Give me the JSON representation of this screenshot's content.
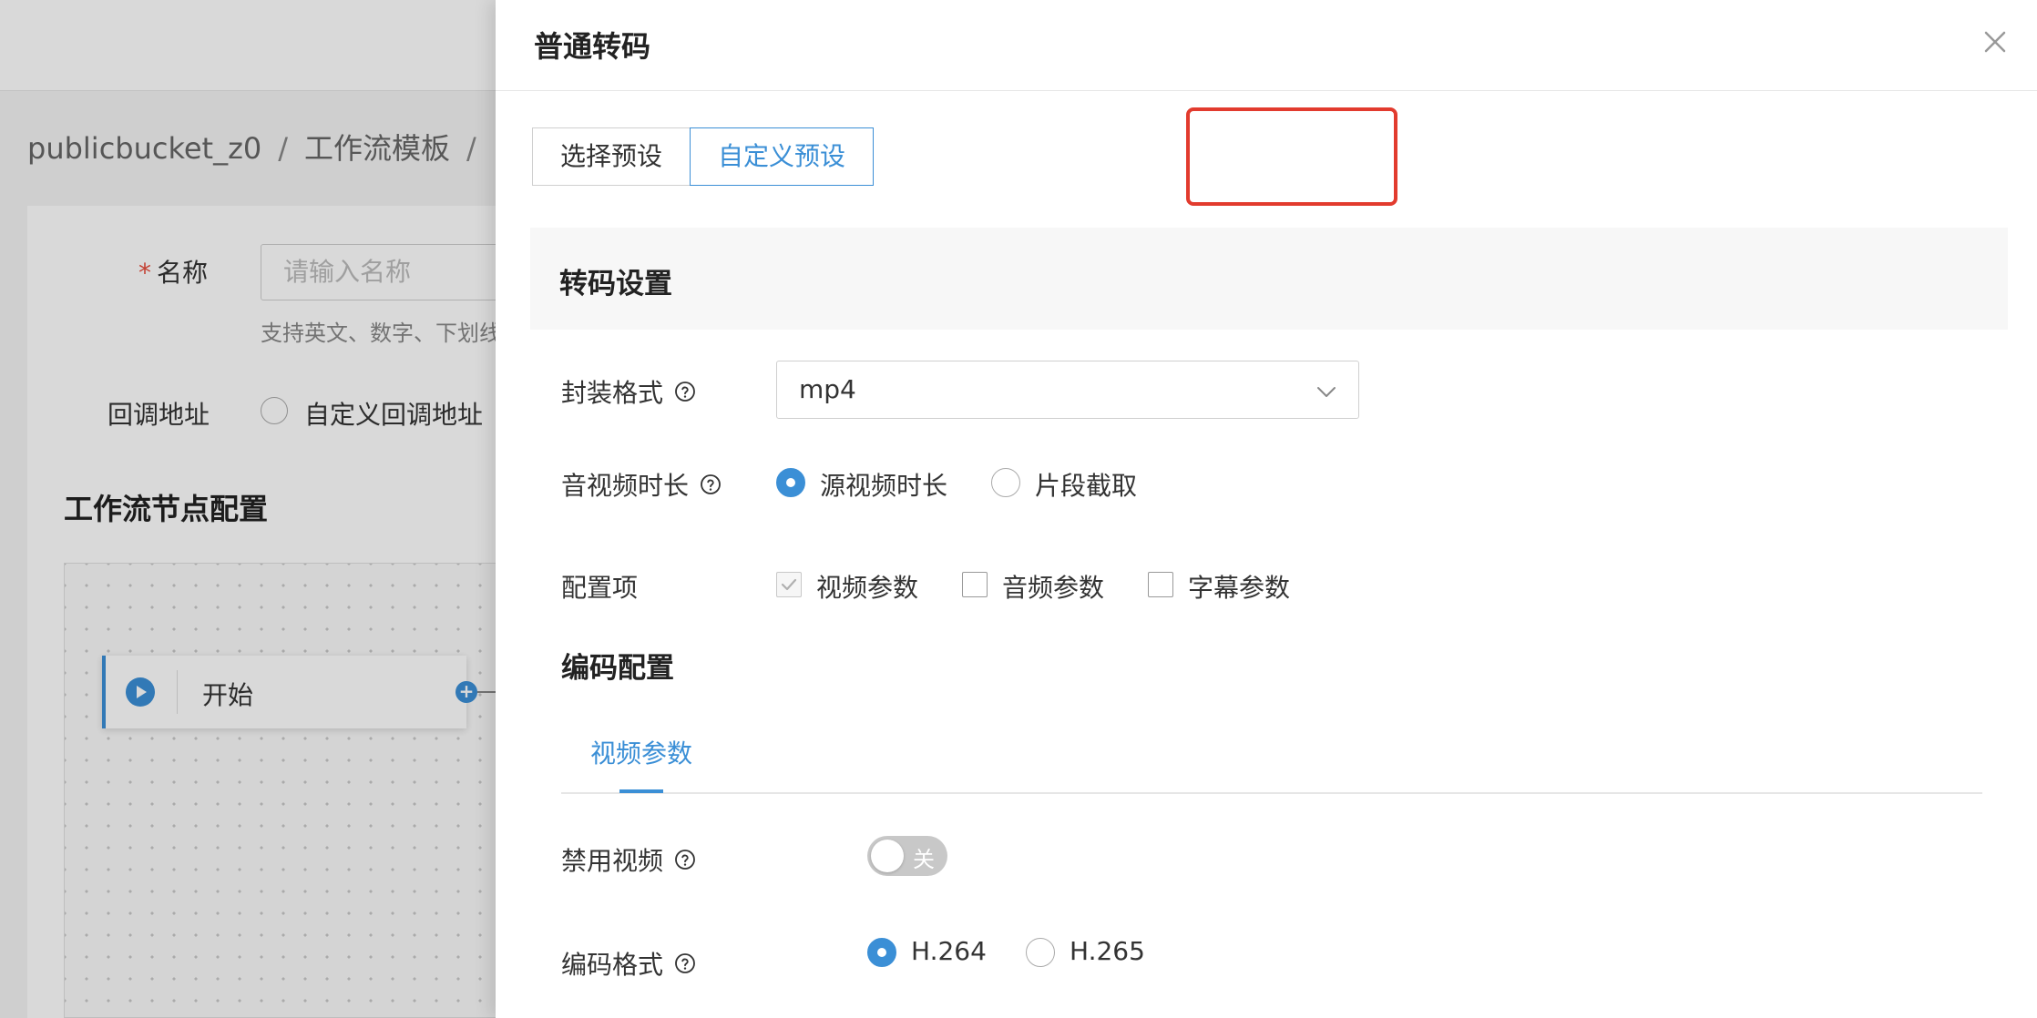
{
  "background": {
    "breadcrumb": [
      "publicbucket_z0",
      "工作流模板",
      "/"
    ],
    "breadcrumb_sep": "/",
    "form": {
      "name_required_mark": "*",
      "name_label": "名称",
      "name_placeholder": "请输入名称",
      "name_hint": "支持英文、数字、下划线",
      "callback_label": "回调地址",
      "callback_option": "自定义回调地址"
    },
    "workflow_section_title": "工作流节点配置",
    "start_node_label": "开始"
  },
  "drawer": {
    "title": "普通转码",
    "tabs": [
      {
        "label": "选择预设",
        "active": false
      },
      {
        "label": "自定义预设",
        "active": true
      }
    ],
    "transcode_settings": {
      "title": "转码设置",
      "container_format": {
        "label": "封装格式",
        "value": "mp4",
        "icon": "question-circle-icon"
      },
      "duration": {
        "label": "音视频时长",
        "options": [
          {
            "label": "源视频时长",
            "checked": true
          },
          {
            "label": "片段截取",
            "checked": false
          }
        ]
      },
      "config_items": {
        "label": "配置项",
        "options": [
          {
            "label": "视频参数",
            "checked": true,
            "disabled": true
          },
          {
            "label": "音频参数",
            "checked": false
          },
          {
            "label": "字幕参数",
            "checked": false
          }
        ]
      }
    },
    "encoding_config": {
      "title": "编码配置",
      "tabs": [
        "视频参数"
      ],
      "disable_video": {
        "label": "禁用视频",
        "toggle_text": "关",
        "on": false
      },
      "codec": {
        "label": "编码格式",
        "options": [
          {
            "label": "H.264",
            "checked": true
          },
          {
            "label": "H.265",
            "checked": false
          }
        ]
      }
    }
  },
  "colors": {
    "accent": "#3b8fd6",
    "highlight_box": "#e23b2e",
    "required_mark": "#e64d3d"
  }
}
